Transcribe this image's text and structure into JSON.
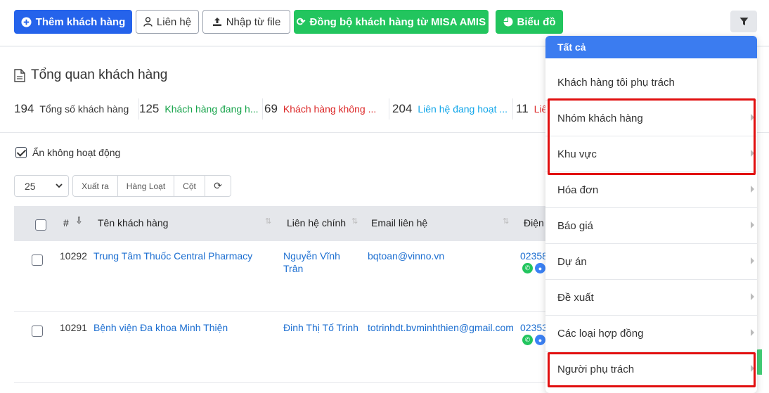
{
  "toolbar": {
    "add_customer": "Thêm khách hàng",
    "contact": "Liên hệ",
    "import": "Nhập từ file",
    "sync": "Đồng bộ khách hàng từ MISA AMIS",
    "chart": "Biểu đồ"
  },
  "overview": {
    "title": "Tổng quan khách hàng",
    "stats": [
      {
        "value": "194",
        "label": "Tổng số khách hàng",
        "color": "#333333"
      },
      {
        "value": "125",
        "label": "Khách hàng đang h...",
        "color": "#16a34a"
      },
      {
        "value": "69",
        "label": "Khách hàng không ...",
        "color": "#dc2626"
      },
      {
        "value": "204",
        "label": "Liên hệ đang hoạt ...",
        "color": "#0ea5e9"
      },
      {
        "value": "11",
        "label": "Liê",
        "color": "#dc2626"
      }
    ]
  },
  "controls": {
    "hide_inactive": "Ẩn không hoạt động",
    "page_size": "25",
    "export": "Xuất ra",
    "bulk": "Hàng Loạt",
    "columns": "Cột"
  },
  "table": {
    "headers": {
      "index": "#",
      "name": "Tên khách hàng",
      "main_contact": "Liên hệ chính",
      "email": "Email liên hệ",
      "phone": "Điện"
    },
    "rows": [
      {
        "id": "10292",
        "name": "Trung Tâm Thuốc Central Pharmacy",
        "contact_line1": "Nguyễn Vĩnh",
        "contact_line2": "Trân",
        "email": "bqtoan@vinno.vn",
        "phone": "02358"
      },
      {
        "id": "10291",
        "name": "Bệnh viện Đa khoa Minh Thiện",
        "contact_line1": "Đinh Thị Tố Trinh",
        "contact_line2": "",
        "email": "totrinhdt.bvminhthien@gmail.com",
        "phone": "02353"
      }
    ]
  },
  "dropdown": {
    "all": "Tất cả",
    "items": [
      "Khách hàng tôi phụ trách",
      "Nhóm khách hàng",
      "Khu vực",
      "Hóa đơn",
      "Báo giá",
      "Dự án",
      "Đề xuất",
      "Các loại hợp đồng",
      "Người phụ trách"
    ]
  },
  "colors": {
    "primary": "#2563eb",
    "success": "#22c55e",
    "highlight": "#e10f0f",
    "link": "#1d6fd1"
  }
}
